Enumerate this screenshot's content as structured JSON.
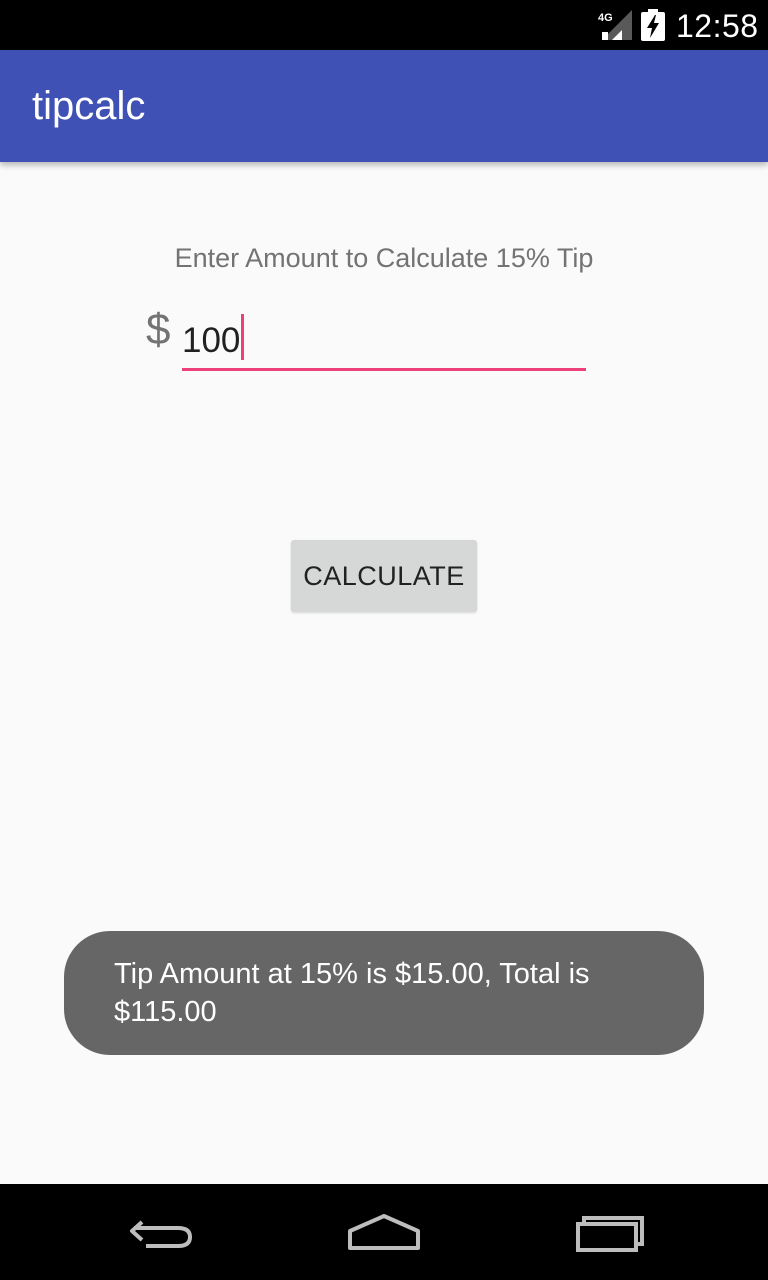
{
  "status_bar": {
    "network_label": "4G",
    "time": "12:58"
  },
  "app_bar": {
    "title": "tipcalc"
  },
  "form": {
    "prompt": "Enter Amount to Calculate 15% Tip",
    "currency_symbol": "$",
    "amount_value": "100"
  },
  "actions": {
    "calculate_label": "CALCULATE"
  },
  "toast": {
    "line1": "Tip Amount at 15% is $15.00, Total is",
    "line2": "$115.00"
  },
  "nav_bar": {
    "icons": [
      "back-icon",
      "home-icon",
      "recents-icon"
    ]
  },
  "colors": {
    "app_bar": "#3f51b5",
    "accent": "#ec407a",
    "toast_bg": "#666666",
    "button_bg": "#d6d7d7"
  }
}
